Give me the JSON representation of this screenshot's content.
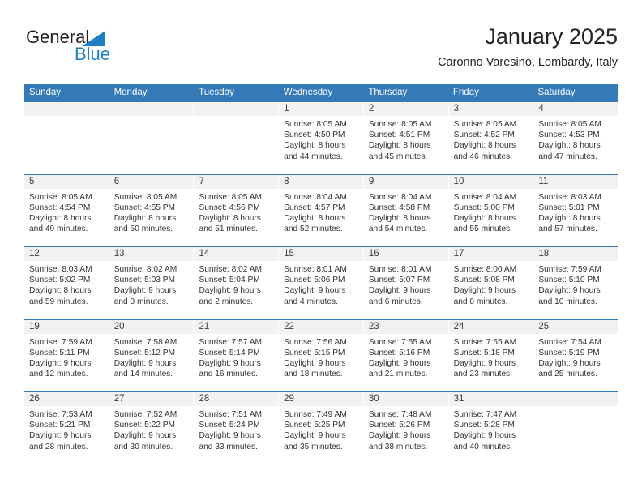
{
  "brand": {
    "name_part1": "General",
    "name_part2": "Blue",
    "color_dark": "#231f20",
    "color_blue": "#1f7fc4"
  },
  "header": {
    "title": "January 2025",
    "subtitle": "Caronno Varesino, Lombardy, Italy"
  },
  "theme": {
    "header_blue": "#3479b8",
    "day_band_gray": "#f2f2f2",
    "text": "#333333"
  },
  "weekdays": [
    "Sunday",
    "Monday",
    "Tuesday",
    "Wednesday",
    "Thursday",
    "Friday",
    "Saturday"
  ],
  "weeks": [
    [
      {
        "day": "",
        "sunrise": "",
        "sunset": "",
        "daylight_line1": "",
        "daylight_line2": ""
      },
      {
        "day": "",
        "sunrise": "",
        "sunset": "",
        "daylight_line1": "",
        "daylight_line2": ""
      },
      {
        "day": "",
        "sunrise": "",
        "sunset": "",
        "daylight_line1": "",
        "daylight_line2": ""
      },
      {
        "day": "1",
        "sunrise": "Sunrise: 8:05 AM",
        "sunset": "Sunset: 4:50 PM",
        "daylight_line1": "Daylight: 8 hours",
        "daylight_line2": "and 44 minutes."
      },
      {
        "day": "2",
        "sunrise": "Sunrise: 8:05 AM",
        "sunset": "Sunset: 4:51 PM",
        "daylight_line1": "Daylight: 8 hours",
        "daylight_line2": "and 45 minutes."
      },
      {
        "day": "3",
        "sunrise": "Sunrise: 8:05 AM",
        "sunset": "Sunset: 4:52 PM",
        "daylight_line1": "Daylight: 8 hours",
        "daylight_line2": "and 46 minutes."
      },
      {
        "day": "4",
        "sunrise": "Sunrise: 8:05 AM",
        "sunset": "Sunset: 4:53 PM",
        "daylight_line1": "Daylight: 8 hours",
        "daylight_line2": "and 47 minutes."
      }
    ],
    [
      {
        "day": "5",
        "sunrise": "Sunrise: 8:05 AM",
        "sunset": "Sunset: 4:54 PM",
        "daylight_line1": "Daylight: 8 hours",
        "daylight_line2": "and 49 minutes."
      },
      {
        "day": "6",
        "sunrise": "Sunrise: 8:05 AM",
        "sunset": "Sunset: 4:55 PM",
        "daylight_line1": "Daylight: 8 hours",
        "daylight_line2": "and 50 minutes."
      },
      {
        "day": "7",
        "sunrise": "Sunrise: 8:05 AM",
        "sunset": "Sunset: 4:56 PM",
        "daylight_line1": "Daylight: 8 hours",
        "daylight_line2": "and 51 minutes."
      },
      {
        "day": "8",
        "sunrise": "Sunrise: 8:04 AM",
        "sunset": "Sunset: 4:57 PM",
        "daylight_line1": "Daylight: 8 hours",
        "daylight_line2": "and 52 minutes."
      },
      {
        "day": "9",
        "sunrise": "Sunrise: 8:04 AM",
        "sunset": "Sunset: 4:58 PM",
        "daylight_line1": "Daylight: 8 hours",
        "daylight_line2": "and 54 minutes."
      },
      {
        "day": "10",
        "sunrise": "Sunrise: 8:04 AM",
        "sunset": "Sunset: 5:00 PM",
        "daylight_line1": "Daylight: 8 hours",
        "daylight_line2": "and 55 minutes."
      },
      {
        "day": "11",
        "sunrise": "Sunrise: 8:03 AM",
        "sunset": "Sunset: 5:01 PM",
        "daylight_line1": "Daylight: 8 hours",
        "daylight_line2": "and 57 minutes."
      }
    ],
    [
      {
        "day": "12",
        "sunrise": "Sunrise: 8:03 AM",
        "sunset": "Sunset: 5:02 PM",
        "daylight_line1": "Daylight: 8 hours",
        "daylight_line2": "and 59 minutes."
      },
      {
        "day": "13",
        "sunrise": "Sunrise: 8:02 AM",
        "sunset": "Sunset: 5:03 PM",
        "daylight_line1": "Daylight: 9 hours",
        "daylight_line2": "and 0 minutes."
      },
      {
        "day": "14",
        "sunrise": "Sunrise: 8:02 AM",
        "sunset": "Sunset: 5:04 PM",
        "daylight_line1": "Daylight: 9 hours",
        "daylight_line2": "and 2 minutes."
      },
      {
        "day": "15",
        "sunrise": "Sunrise: 8:01 AM",
        "sunset": "Sunset: 5:06 PM",
        "daylight_line1": "Daylight: 9 hours",
        "daylight_line2": "and 4 minutes."
      },
      {
        "day": "16",
        "sunrise": "Sunrise: 8:01 AM",
        "sunset": "Sunset: 5:07 PM",
        "daylight_line1": "Daylight: 9 hours",
        "daylight_line2": "and 6 minutes."
      },
      {
        "day": "17",
        "sunrise": "Sunrise: 8:00 AM",
        "sunset": "Sunset: 5:08 PM",
        "daylight_line1": "Daylight: 9 hours",
        "daylight_line2": "and 8 minutes."
      },
      {
        "day": "18",
        "sunrise": "Sunrise: 7:59 AM",
        "sunset": "Sunset: 5:10 PM",
        "daylight_line1": "Daylight: 9 hours",
        "daylight_line2": "and 10 minutes."
      }
    ],
    [
      {
        "day": "19",
        "sunrise": "Sunrise: 7:59 AM",
        "sunset": "Sunset: 5:11 PM",
        "daylight_line1": "Daylight: 9 hours",
        "daylight_line2": "and 12 minutes."
      },
      {
        "day": "20",
        "sunrise": "Sunrise: 7:58 AM",
        "sunset": "Sunset: 5:12 PM",
        "daylight_line1": "Daylight: 9 hours",
        "daylight_line2": "and 14 minutes."
      },
      {
        "day": "21",
        "sunrise": "Sunrise: 7:57 AM",
        "sunset": "Sunset: 5:14 PM",
        "daylight_line1": "Daylight: 9 hours",
        "daylight_line2": "and 16 minutes."
      },
      {
        "day": "22",
        "sunrise": "Sunrise: 7:56 AM",
        "sunset": "Sunset: 5:15 PM",
        "daylight_line1": "Daylight: 9 hours",
        "daylight_line2": "and 18 minutes."
      },
      {
        "day": "23",
        "sunrise": "Sunrise: 7:55 AM",
        "sunset": "Sunset: 5:16 PM",
        "daylight_line1": "Daylight: 9 hours",
        "daylight_line2": "and 21 minutes."
      },
      {
        "day": "24",
        "sunrise": "Sunrise: 7:55 AM",
        "sunset": "Sunset: 5:18 PM",
        "daylight_line1": "Daylight: 9 hours",
        "daylight_line2": "and 23 minutes."
      },
      {
        "day": "25",
        "sunrise": "Sunrise: 7:54 AM",
        "sunset": "Sunset: 5:19 PM",
        "daylight_line1": "Daylight: 9 hours",
        "daylight_line2": "and 25 minutes."
      }
    ],
    [
      {
        "day": "26",
        "sunrise": "Sunrise: 7:53 AM",
        "sunset": "Sunset: 5:21 PM",
        "daylight_line1": "Daylight: 9 hours",
        "daylight_line2": "and 28 minutes."
      },
      {
        "day": "27",
        "sunrise": "Sunrise: 7:52 AM",
        "sunset": "Sunset: 5:22 PM",
        "daylight_line1": "Daylight: 9 hours",
        "daylight_line2": "and 30 minutes."
      },
      {
        "day": "28",
        "sunrise": "Sunrise: 7:51 AM",
        "sunset": "Sunset: 5:24 PM",
        "daylight_line1": "Daylight: 9 hours",
        "daylight_line2": "and 33 minutes."
      },
      {
        "day": "29",
        "sunrise": "Sunrise: 7:49 AM",
        "sunset": "Sunset: 5:25 PM",
        "daylight_line1": "Daylight: 9 hours",
        "daylight_line2": "and 35 minutes."
      },
      {
        "day": "30",
        "sunrise": "Sunrise: 7:48 AM",
        "sunset": "Sunset: 5:26 PM",
        "daylight_line1": "Daylight: 9 hours",
        "daylight_line2": "and 38 minutes."
      },
      {
        "day": "31",
        "sunrise": "Sunrise: 7:47 AM",
        "sunset": "Sunset: 5:28 PM",
        "daylight_line1": "Daylight: 9 hours",
        "daylight_line2": "and 40 minutes."
      },
      {
        "day": "",
        "sunrise": "",
        "sunset": "",
        "daylight_line1": "",
        "daylight_line2": ""
      }
    ]
  ]
}
